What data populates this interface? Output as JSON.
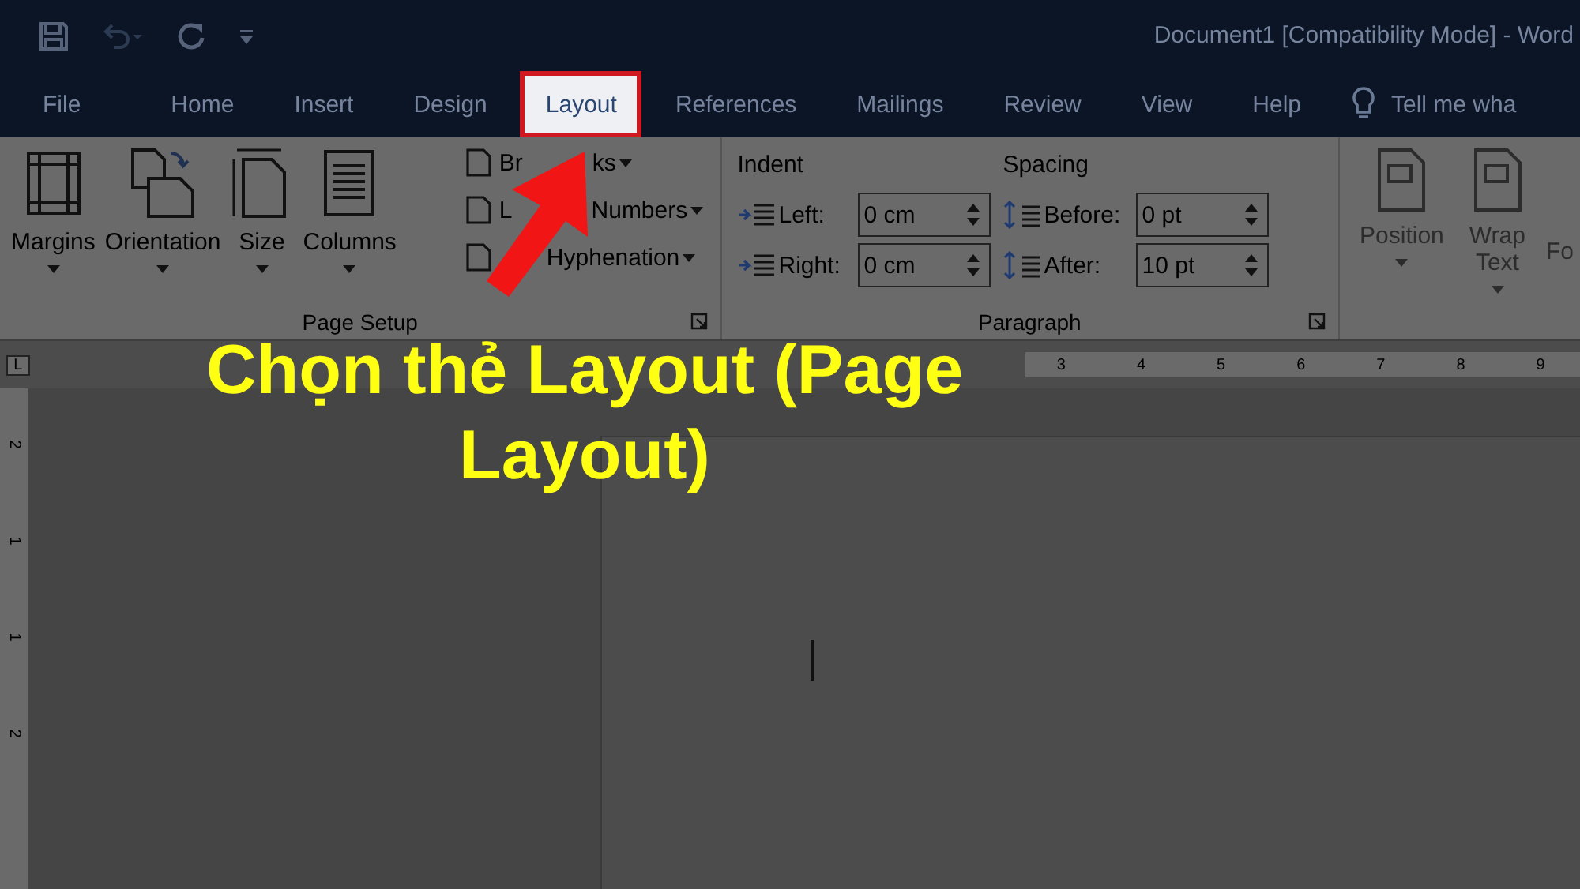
{
  "window": {
    "title": "Document1 [Compatibility Mode]  -  Word"
  },
  "tabs": [
    {
      "label": "File",
      "selected": false
    },
    {
      "label": "Home",
      "selected": false
    },
    {
      "label": "Insert",
      "selected": false
    },
    {
      "label": "Design",
      "selected": false
    },
    {
      "label": "Layout",
      "selected": true
    },
    {
      "label": "References",
      "selected": false
    },
    {
      "label": "Mailings",
      "selected": false
    },
    {
      "label": "Review",
      "selected": false
    },
    {
      "label": "View",
      "selected": false
    },
    {
      "label": "Help",
      "selected": false
    }
  ],
  "tell_me": "Tell me wha",
  "page_setup": {
    "label": "Page Setup",
    "large_buttons": [
      {
        "label": "Margins"
      },
      {
        "label": "Orientation"
      },
      {
        "label": "Size"
      },
      {
        "label": "Columns"
      }
    ],
    "small_buttons": [
      {
        "parts": [
          "Br",
          "ks"
        ]
      },
      {
        "parts": [
          "L",
          "Numbers"
        ]
      },
      {
        "parts": [
          "Hyphenation"
        ]
      }
    ]
  },
  "paragraph": {
    "label": "Paragraph",
    "indent_label": "Indent",
    "spacing_label": "Spacing",
    "indent": [
      {
        "label": "Left:",
        "value": "0 cm"
      },
      {
        "label": "Right:",
        "value": "0 cm"
      }
    ],
    "spacing": [
      {
        "label": "Before:",
        "value": "0 pt"
      },
      {
        "label": "After:",
        "value": "10 pt"
      }
    ]
  },
  "arrange": {
    "buttons": [
      {
        "lines": [
          "Position"
        ],
        "disabled": true
      },
      {
        "lines": [
          "Wrap",
          "Text"
        ],
        "disabled": true
      }
    ],
    "cut_label": "Fo"
  },
  "ruler": {
    "tab_stop": "L",
    "numbers": [
      "3",
      "4",
      "5",
      "6",
      "7",
      "8",
      "9"
    ],
    "vertical_numbers": [
      "2",
      "1",
      "1",
      "2"
    ]
  },
  "annotation": {
    "text": "Chọn thẻ Layout (Page Layout)"
  }
}
